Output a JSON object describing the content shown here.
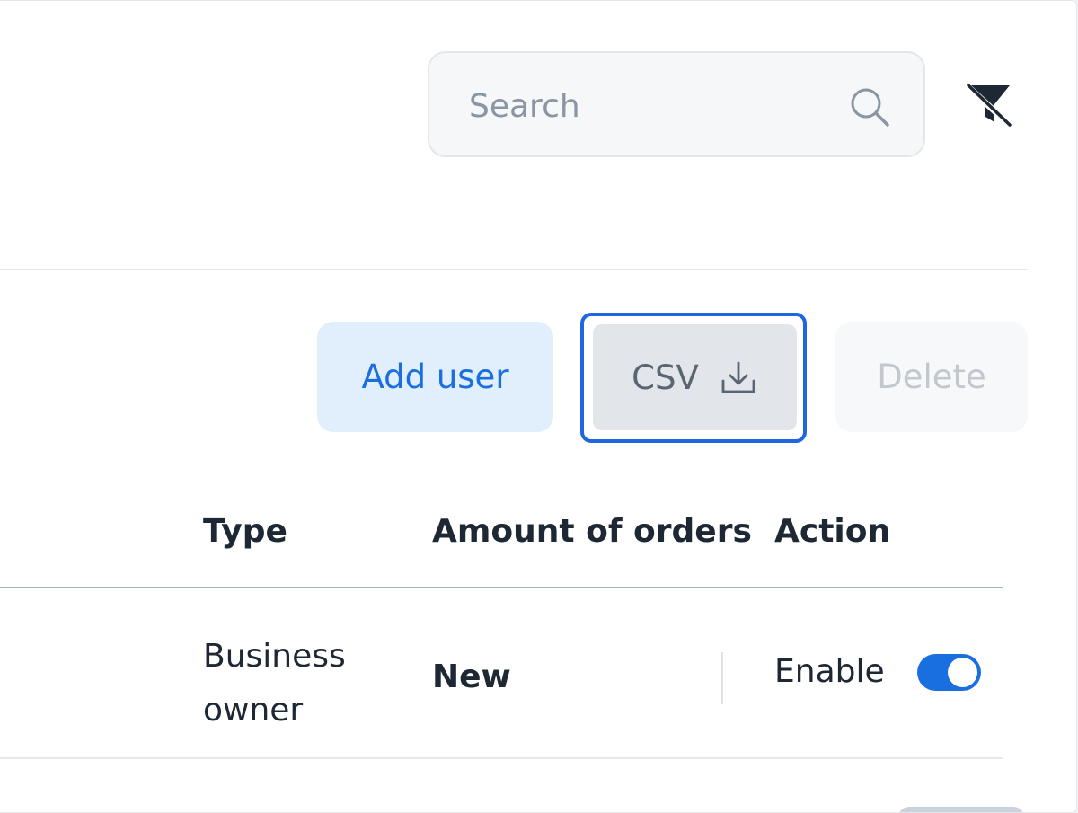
{
  "search": {
    "placeholder": "Search",
    "icon": "search-icon"
  },
  "filter": {
    "icon": "filter-off-icon"
  },
  "toolbar": {
    "add_label": "Add user",
    "csv_label": "CSV",
    "csv_icon": "download-icon",
    "delete_label": "Delete"
  },
  "table": {
    "columns": [
      "Type",
      "Amount of orders",
      "Action"
    ],
    "rows": [
      {
        "type": "Business owner",
        "orders": "New",
        "action_label": "Enable",
        "enabled": true
      }
    ]
  },
  "colors": {
    "accent": "#1a6fe0",
    "focus_ring": "#1f66e0",
    "text": "#1e2835"
  }
}
